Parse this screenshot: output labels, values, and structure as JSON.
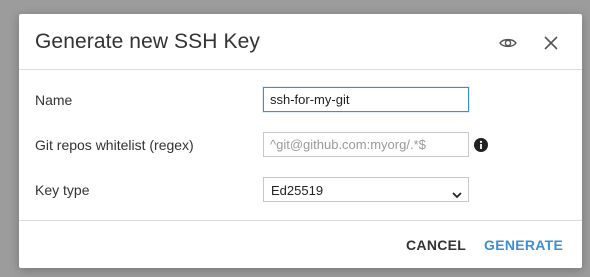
{
  "dialog": {
    "title": "Generate new SSH Key",
    "icons": {
      "toggle_visibility": "eye-icon",
      "close": "close-icon"
    }
  },
  "form": {
    "name": {
      "label": "Name",
      "value": "ssh-for-my-git",
      "placeholder": ""
    },
    "git_whitelist": {
      "label": "Git repos whitelist (regex)",
      "value": "",
      "placeholder": "^git@github.com:myorg/.*$",
      "info_icon": "info-icon"
    },
    "key_type": {
      "label": "Key type",
      "selected": "Ed25519"
    }
  },
  "footer": {
    "cancel_label": "CANCEL",
    "generate_label": "GENERATE"
  },
  "colors": {
    "accent": "#3a8fd6",
    "text": "#333333",
    "divider": "#dcdcdc"
  }
}
